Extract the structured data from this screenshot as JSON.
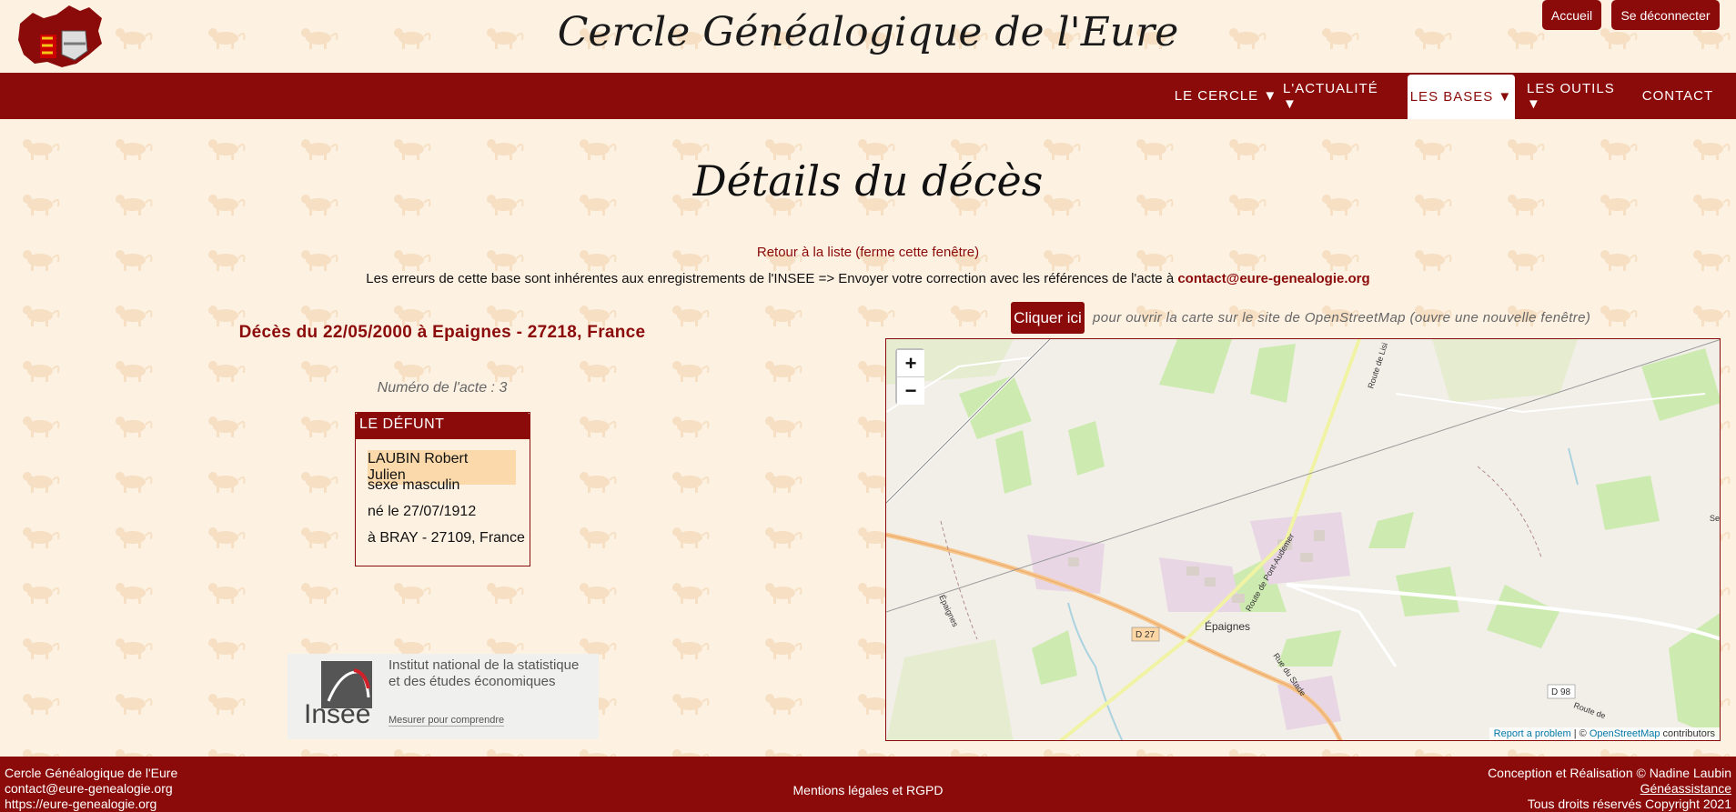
{
  "header": {
    "site_title": "Cercle Généalogique de l'Eure",
    "accueil_label": "Accueil",
    "logout_label": "Se déconnecter"
  },
  "nav": {
    "items": [
      {
        "label": "LE CERCLE ▼"
      },
      {
        "label": "L'ACTUALITÉ ▼"
      },
      {
        "label": "LES BASES ▼"
      },
      {
        "label": "LES OUTILS ▼"
      },
      {
        "label": "CONTACT"
      }
    ],
    "active": "LES BASES ▼"
  },
  "page": {
    "title": "Détails du décès",
    "back_link": "Retour à la liste (ferme cette fenêtre)",
    "errors_text": "Les erreurs de cette base sont inhérentes aux enregistrements de l'INSEE => Envoyer votre correction avec les références de l'acte à",
    "errors_email": "contact@eure-genealogie.org",
    "death_title": "Décès du 22/05/2000 à Epaignes - 27218, France",
    "act_number": "Numéro de l'acte : 3"
  },
  "defunt": {
    "header": "LE DÉFUNT",
    "name": "LAUBIN Robert Julien",
    "sex": "sexe masculin",
    "birth": "né le 27/07/1912",
    "birthplace": "à BRAY - 27109, France"
  },
  "map": {
    "cliquer_label": "Cliquer ici",
    "osm_text": "pour ouvrir la carte sur le site de OpenStreetMap (ouvre une nouvelle fenêtre)",
    "zoom_in": "+",
    "zoom_out": "−",
    "attrib_report": "Report a problem",
    "attrib_sep": " | © ",
    "attrib_osm": "OpenStreetMap",
    "attrib_contrib": " contributors",
    "labels": {
      "town": "Épaignes",
      "d27": "D 27",
      "d98": "D 98",
      "route_pont": "Route de Pont-Audemer",
      "route_lisi": "Route de Lisi",
      "rue_stade": "Rue du Stade",
      "epaignes_river": "Épaignes",
      "route_de": "Route de",
      "se": "Se"
    }
  },
  "insee": {
    "line1": "Institut national de la statistique",
    "line2": "et des études économiques",
    "tagline": "Mesurer pour comprendre",
    "word": "Insee"
  },
  "footer": {
    "left1": "Cercle Généalogique de l'Eure",
    "left2": "contact@eure-genealogie.org",
    "left3": "https://eure-genealogie.org",
    "center": "Mentions légales et RGPD",
    "right1": "Conception et Réalisation © Nadine Laubin",
    "right2": "Généassistance",
    "right3": "Tous droits réservés Copyright 2021"
  },
  "colors": {
    "brand": "#8b0a0a",
    "background": "#fdf1e2",
    "highlight": "#fbd9ab"
  }
}
